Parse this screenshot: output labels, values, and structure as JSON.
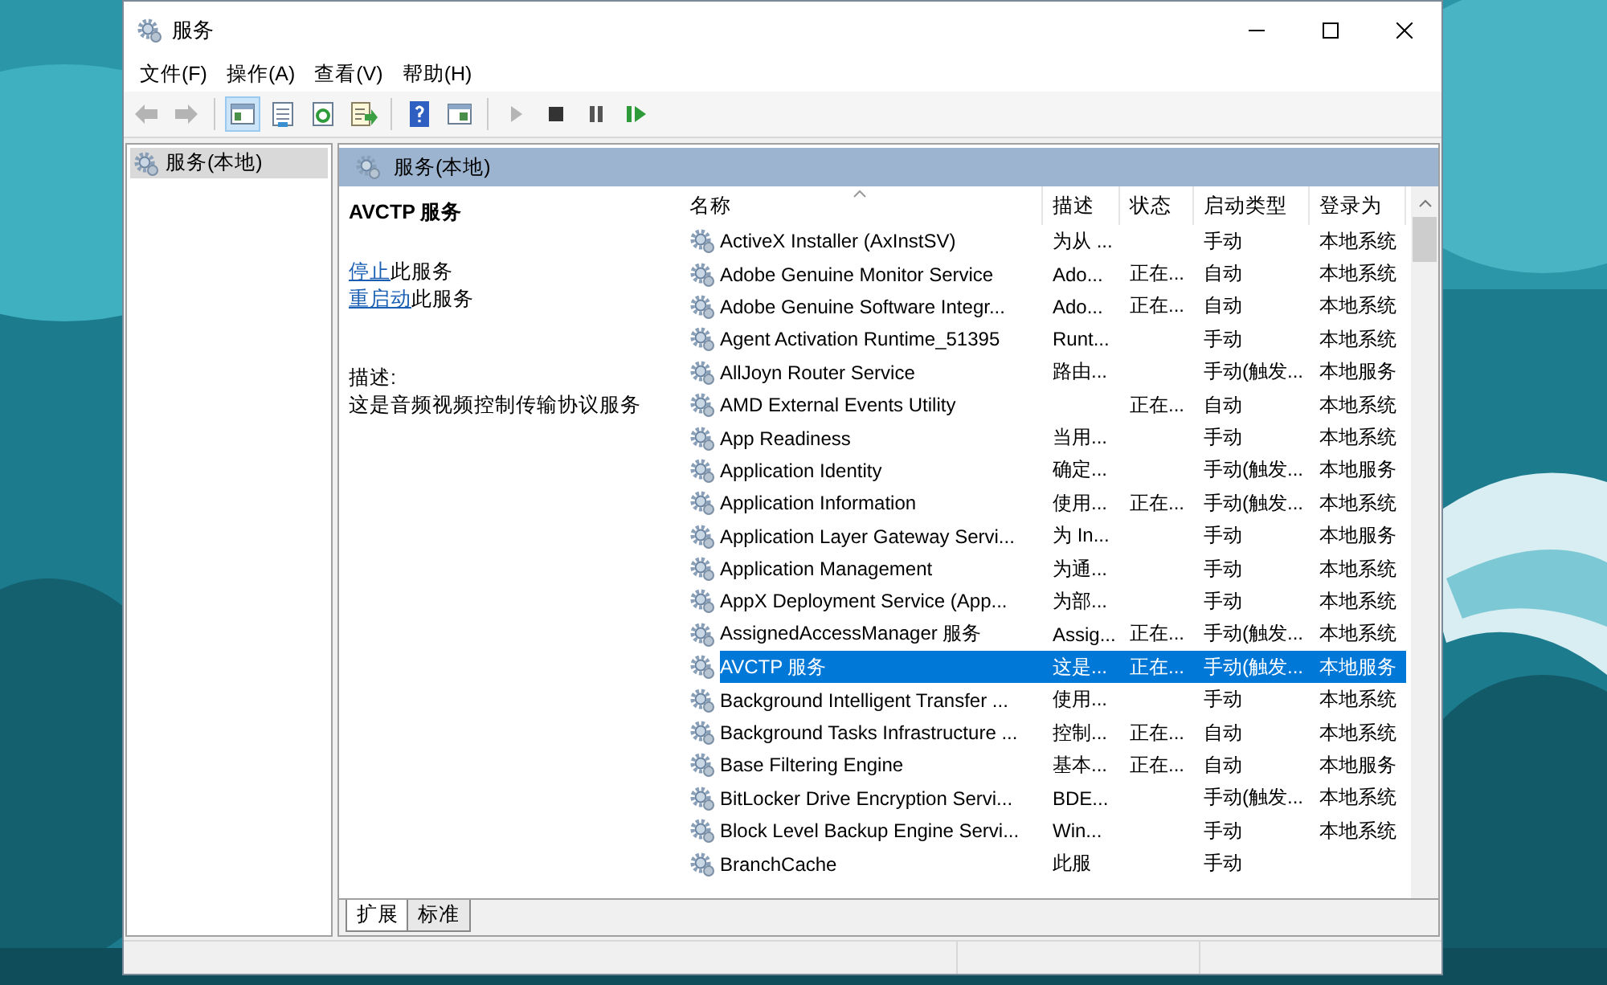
{
  "window": {
    "title": "服务"
  },
  "menu": [
    "文件(F)",
    "操作(A)",
    "查看(V)",
    "帮助(H)"
  ],
  "toolbar": [
    {
      "kind": "back",
      "disabled": true,
      "selected": false
    },
    {
      "kind": "forward",
      "disabled": true,
      "selected": false
    },
    {
      "kind": "tree",
      "disabled": false,
      "selected": true
    },
    {
      "kind": "properties",
      "disabled": false,
      "selected": false
    },
    {
      "kind": "refresh",
      "disabled": false,
      "selected": false
    },
    {
      "kind": "export",
      "disabled": false,
      "selected": false
    },
    {
      "kind": "help",
      "disabled": false,
      "selected": false
    },
    {
      "kind": "pane",
      "disabled": false,
      "selected": false
    },
    {
      "kind": "play",
      "disabled": true,
      "selected": false
    },
    {
      "kind": "stop",
      "disabled": false,
      "selected": false
    },
    {
      "kind": "pause",
      "disabled": false,
      "selected": false
    },
    {
      "kind": "resume",
      "disabled": false,
      "selected": false
    }
  ],
  "tree": {
    "items": [
      {
        "label": "服务(本地)",
        "selected": true
      }
    ]
  },
  "panel_header": "服务(本地)",
  "detail": {
    "title": "AVCTP 服务",
    "actions": [
      {
        "link": "停止",
        "text": "此服务"
      },
      {
        "link": "重启动",
        "text": "此服务"
      }
    ],
    "description_label": "描述:",
    "description": "这是音频视频控制传输协议服务"
  },
  "table": {
    "columns": [
      "名称",
      "描述",
      "状态",
      "启动类型",
      "登录为"
    ],
    "rows": [
      {
        "name": "ActiveX Installer (AxInstSV)",
        "description": "为从 ...",
        "status": "",
        "startup": "手动",
        "login": "本地系统",
        "selected": false
      },
      {
        "name": "Adobe Genuine Monitor Service",
        "description": "Ado...",
        "status": "正在...",
        "startup": "自动",
        "login": "本地系统",
        "selected": false
      },
      {
        "name": "Adobe Genuine Software Integr...",
        "description": "Ado...",
        "status": "正在...",
        "startup": "自动",
        "login": "本地系统",
        "selected": false
      },
      {
        "name": "Agent Activation Runtime_51395",
        "description": "Runt...",
        "status": "",
        "startup": "手动",
        "login": "本地系统",
        "selected": false
      },
      {
        "name": "AllJoyn Router Service",
        "description": "路由...",
        "status": "",
        "startup": "手动(触发...",
        "login": "本地服务",
        "selected": false
      },
      {
        "name": "AMD External Events Utility",
        "description": "",
        "status": "正在...",
        "startup": "自动",
        "login": "本地系统",
        "selected": false
      },
      {
        "name": "App Readiness",
        "description": "当用...",
        "status": "",
        "startup": "手动",
        "login": "本地系统",
        "selected": false
      },
      {
        "name": "Application Identity",
        "description": "确定...",
        "status": "",
        "startup": "手动(触发...",
        "login": "本地服务",
        "selected": false
      },
      {
        "name": "Application Information",
        "description": "使用...",
        "status": "正在...",
        "startup": "手动(触发...",
        "login": "本地系统",
        "selected": false
      },
      {
        "name": "Application Layer Gateway Servi...",
        "description": "为 In...",
        "status": "",
        "startup": "手动",
        "login": "本地服务",
        "selected": false
      },
      {
        "name": "Application Management",
        "description": "为通...",
        "status": "",
        "startup": "手动",
        "login": "本地系统",
        "selected": false
      },
      {
        "name": "AppX Deployment Service (App...",
        "description": "为部...",
        "status": "",
        "startup": "手动",
        "login": "本地系统",
        "selected": false
      },
      {
        "name": "AssignedAccessManager 服务",
        "description": "Assig...",
        "status": "正在...",
        "startup": "手动(触发...",
        "login": "本地系统",
        "selected": false
      },
      {
        "name": "AVCTP 服务",
        "description": "这是...",
        "status": "正在...",
        "startup": "手动(触发...",
        "login": "本地服务",
        "selected": true
      },
      {
        "name": "Background Intelligent Transfer ...",
        "description": "使用...",
        "status": "",
        "startup": "手动",
        "login": "本地系统",
        "selected": false
      },
      {
        "name": "Background Tasks Infrastructure ...",
        "description": "控制...",
        "status": "正在...",
        "startup": "自动",
        "login": "本地系统",
        "selected": false
      },
      {
        "name": "Base Filtering Engine",
        "description": "基本...",
        "status": "正在...",
        "startup": "自动",
        "login": "本地服务",
        "selected": false
      },
      {
        "name": "BitLocker Drive Encryption Servi...",
        "description": "BDE...",
        "status": "",
        "startup": "手动(触发...",
        "login": "本地系统",
        "selected": false
      },
      {
        "name": "Block Level Backup Engine Servi...",
        "description": "Win...",
        "status": "",
        "startup": "手动",
        "login": "本地系统",
        "selected": false
      },
      {
        "name": "BranchCache",
        "description": "此服",
        "status": "",
        "startup": "手动",
        "login": "",
        "selected": false
      }
    ]
  },
  "tabs": [
    {
      "label": "扩展",
      "selected": true
    },
    {
      "label": "标准",
      "selected": false
    }
  ]
}
